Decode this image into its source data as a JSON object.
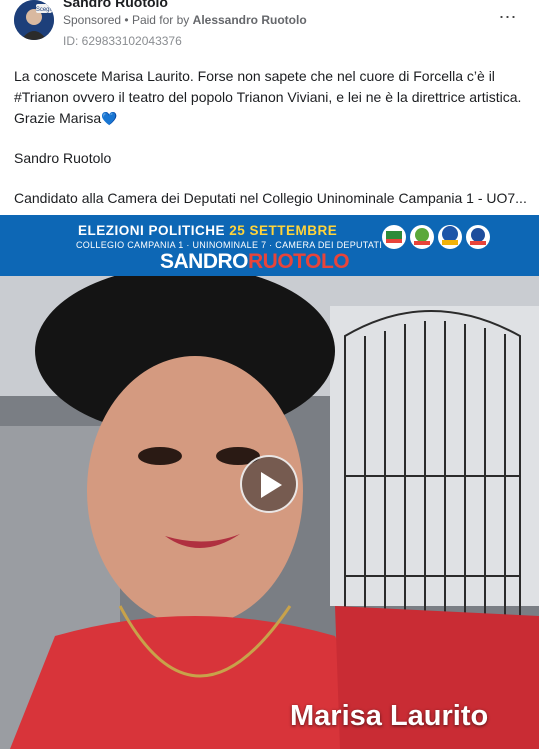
{
  "post": {
    "author": "Sandro Ruotolo",
    "sponsored_label": "Sponsored",
    "separator": "•",
    "paid_for_prefix": "Paid for by",
    "paid_for_name": "Alessandro Ruotolo",
    "ad_id": "ID: 629833102043376",
    "more_icon": "⋯",
    "text_lines": [
      "La conoscete Marisa Laurito. Forse non sapete che nel cuore di Forcella c’è il",
      "#Trianon ovvero il teatro del popolo Trianon Viviani, e lei ne è la direttrice artistica.",
      "Grazie Marisa"
    ],
    "heart": "💙",
    "signature": "Sandro Ruotolo",
    "candidate_line": "Candidato alla Camera dei Deputati nel Collegio Uninominale Campania 1 - UO7..."
  },
  "banner": {
    "line1_a": "ELEZIONI POLITICHE",
    "line1_b": "25 SETTEMBRE",
    "line2": "COLLEGIO CAMPANIA 1 · UNINOMINALE 7 · CAMERA DEI DEPUTATI",
    "name_first": "SANDRO",
    "name_last": "RUOTOLO",
    "avatar_caption": "Scegli"
  },
  "video": {
    "caption": "Marisa Laurito"
  },
  "colors": {
    "banner_blue": "#0d67b5",
    "accent_red": "#e8443a",
    "accent_yellow": "#ffd43b",
    "heart_blue": "#3b8fe0"
  }
}
